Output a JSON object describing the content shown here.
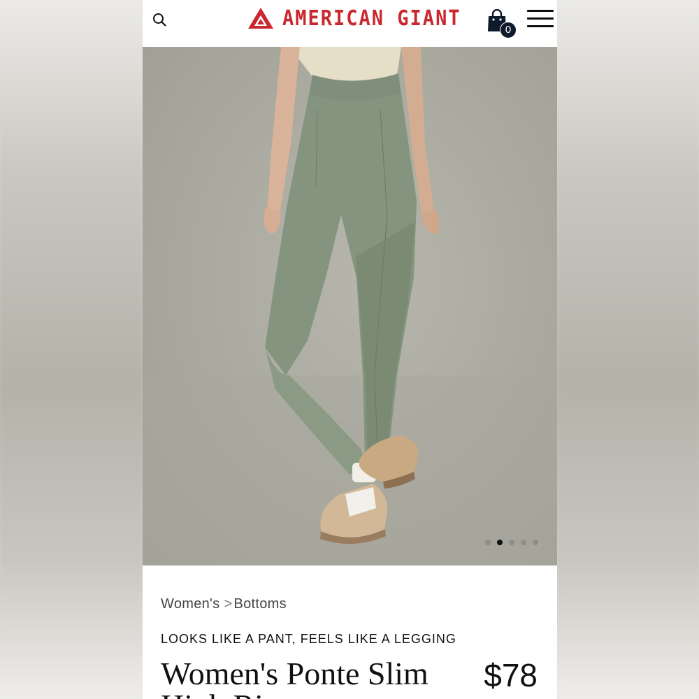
{
  "brand": {
    "name": "AMERICAN GIANT",
    "color": "#c8282e"
  },
  "header": {
    "cart_count": "0",
    "icons": [
      "search-icon",
      "logo-mark",
      "shopping-bag-icon",
      "hamburger-menu-icon"
    ]
  },
  "gallery": {
    "image_count": 5,
    "active_index": 1
  },
  "product": {
    "breadcrumb": {
      "category": "Women's",
      "separator": ">",
      "subcategory": "Bottoms"
    },
    "tagline": "LOOKS LIKE A PANT, FEELS LIKE A LEGGING",
    "title": "Women's Ponte Slim High Rise",
    "price": "$78"
  }
}
